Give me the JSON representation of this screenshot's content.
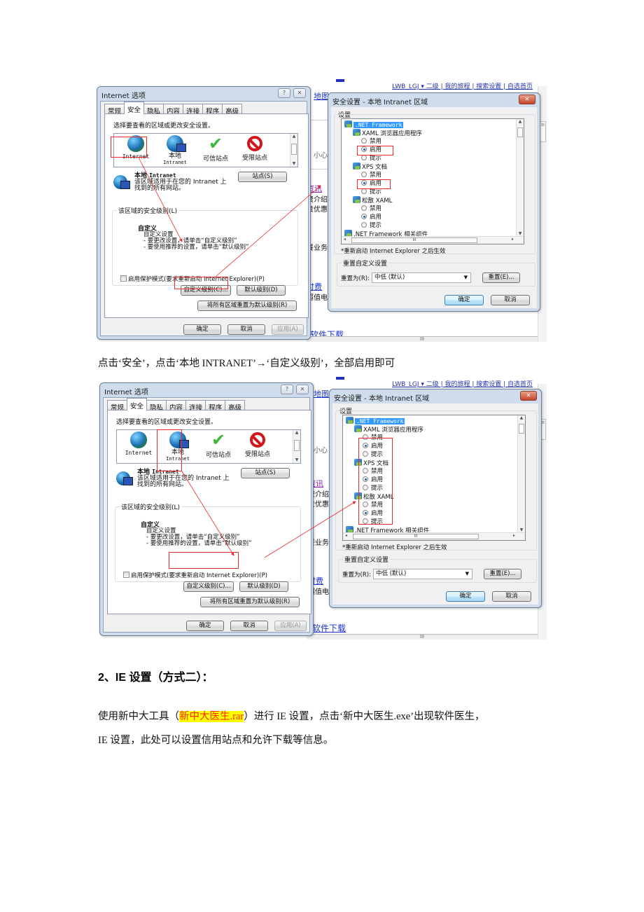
{
  "screenshots": [
    {
      "variant": "first",
      "background_page": {
        "top_links": "LWB_LGJ ▾  二级 | 我的旅程 | 搜索设置 | 自选首页",
        "map_link": "地图",
        "fragments": [
          "小心",
          "资讯",
          "费介绍",
          "贵优惠",
          "餐业务",
          "付费",
          "超值电"
        ],
        "download_link": "软件下载",
        "hscroll_glyph": "III"
      }
    },
    {
      "variant": "second"
    }
  ],
  "internet_options": {
    "title": "Internet 选项",
    "help_button": "?",
    "close_button": "✕",
    "tabs": [
      "常规",
      "安全",
      "隐私",
      "内容",
      "连接",
      "程序",
      "高级"
    ],
    "active_tab": "安全",
    "zone_prompt": "选择要查看的区域或更改安全设置。",
    "zones": [
      {
        "label": "Internet",
        "sub": "",
        "icon": "globe-icon"
      },
      {
        "label": "本地",
        "sub": "Intranet",
        "icon": "intranet-icon"
      },
      {
        "label": "可信站点",
        "sub": "",
        "icon": "checkmark-icon"
      },
      {
        "label": "受限站点",
        "sub": "",
        "icon": "restricted-icon"
      }
    ],
    "zone_title_cn": "本地",
    "zone_title_en": "Intranet",
    "sites_button": "站点(S)",
    "zone_desc_line1": "该区域适用于在您的 Intranet 上",
    "zone_desc_line2": "找到的所有网站。",
    "security_level_group": "该区域的安全级别(L)",
    "level_name": "自定义",
    "level_desc": [
      "自定义设置",
      "- 要更改设置，请单击“自定义级别”",
      "- 要使用推荐的设置，请单击“默认级别”"
    ],
    "protected_mode": "启用保护模式(要求重新启动 Internet Explorer)(P)",
    "custom_level_button": "自定义级别(C)...",
    "default_level_button": "默认级别(D)",
    "reset_all_button": "将所有区域重置为默认级别(R)",
    "ok": "确定",
    "cancel": "取消",
    "apply": "应用(A)"
  },
  "security_settings": {
    "title": "安全设置 - 本地 Intranet 区域",
    "close_button": "✕",
    "settings_label": "设置",
    "tree": [
      {
        "type": "category",
        "label": ".NET Framework",
        "selected": true
      },
      {
        "type": "setting",
        "label": "XAML 浏览器应用程序"
      },
      {
        "type": "option",
        "label": "禁用",
        "checked": false
      },
      {
        "type": "option",
        "label": "启用",
        "checked": true
      },
      {
        "type": "option",
        "label": "提示",
        "checked": false
      },
      {
        "type": "setting",
        "label": "XPS 文档"
      },
      {
        "type": "option",
        "label": "禁用",
        "checked": false
      },
      {
        "type": "option",
        "label": "启用",
        "checked": true
      },
      {
        "type": "option",
        "label": "提示",
        "checked": false
      },
      {
        "type": "setting",
        "label": "松散 XAML"
      },
      {
        "type": "option",
        "label": "禁用",
        "checked": false
      },
      {
        "type": "option",
        "label": "启用",
        "checked": true
      },
      {
        "type": "option",
        "label": "提示",
        "checked": false
      },
      {
        "type": "category",
        "label": ".NET Framework 相关组件",
        "selected": false
      }
    ],
    "hscroll_glyph": "III",
    "restart_note": "*重新启动 Internet Explorer 之后生效",
    "reset_group": "重置自定义设置",
    "reset_to_label": "重置为(R):",
    "reset_to_value": "中低 (默认)",
    "reset_button": "重置(E)...",
    "ok": "确定",
    "cancel": "取消"
  },
  "document": {
    "caption": "点击‘安全’，点击‘本地 INTRANET’→‘自定义级别’，全部启用即可",
    "heading": "2、IE 设置（方式二）：",
    "para_prefix": "使用新中大工具（",
    "para_highlight": "新中大医生.rar",
    "para_suffix": "）进行 IE 设置，点击‘新中大医生.exe’出现软件医生，",
    "para_line2": "IE 设置，此处可以设置信用站点和允许下载等信息。",
    "highlight_color": "#ffff00",
    "highlight_text_color": "#ff2a00"
  },
  "annotation_color": "#e8282e"
}
